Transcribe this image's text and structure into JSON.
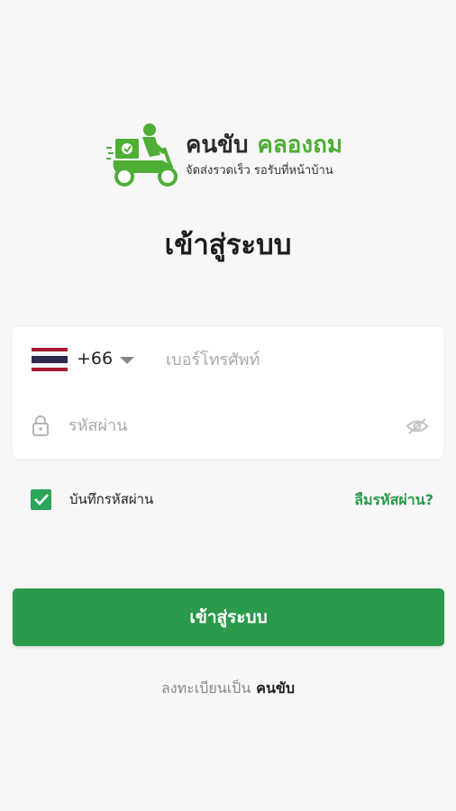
{
  "brand": {
    "name_part1": "คนขับ",
    "name_part2": "คลองถม",
    "tagline": "จัดส่งรวดเร็ว รอรับที่หน้าบ้าน",
    "logo_icon": "delivery-scooter-icon",
    "green": "#4fae35"
  },
  "page": {
    "title": "เข้าสู่ระบบ"
  },
  "form": {
    "country_code": "+66",
    "country_flag": "thailand-flag-icon",
    "phone_placeholder": "เบอร์โทรศัพท์",
    "phone_value": "",
    "password_placeholder": "รหัสผ่าน",
    "password_value": "",
    "remember_label": "บันทึกรหัสผ่าน",
    "remember_checked": true,
    "forgot_label": "ลืมรหัสผ่าน?"
  },
  "actions": {
    "login_label": "เข้าสู่ระบบ",
    "register_prefix": "ลงทะเบียนเป็น",
    "register_link": "คนขับ"
  },
  "colors": {
    "primary": "#2c9a4c",
    "checkbox": "#2aa55a",
    "background": "#f7f7f7"
  }
}
